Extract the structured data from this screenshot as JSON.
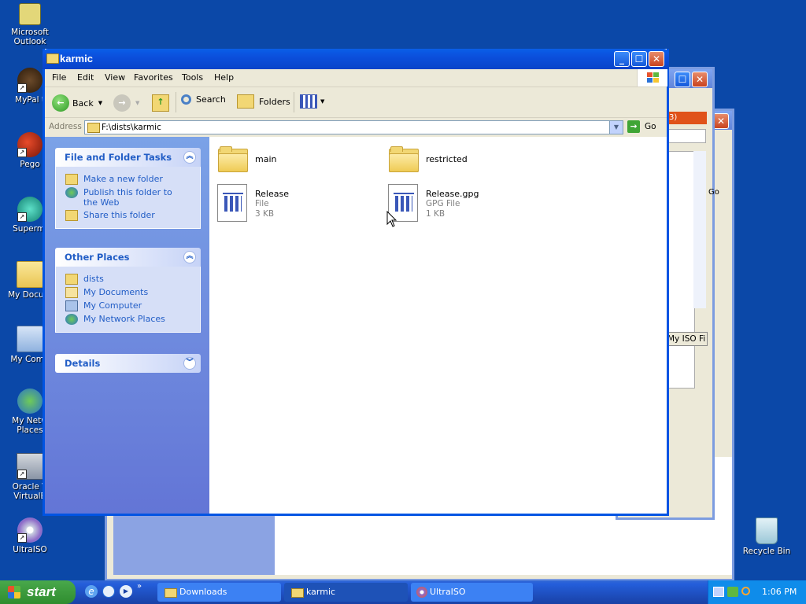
{
  "desktop": {
    "icons": [
      {
        "label": "Microsoft\nOutlook",
        "label1": "Microsoft",
        "label2": "Outlook"
      },
      {
        "label1": "MyPal t",
        "label2": ""
      },
      {
        "label1": "Pego",
        "label2": ""
      },
      {
        "label1": "Supermi",
        "label2": ""
      },
      {
        "label1": "My Docum",
        "label2": ""
      },
      {
        "label1": "My Comp",
        "label2": ""
      },
      {
        "label1": "My Netw",
        "label2": "Places"
      },
      {
        "label1": "Oracle V",
        "label2": "VirtualB"
      },
      {
        "label1": "UltraISO",
        "label2": ""
      }
    ],
    "recycle_bin": "Recycle Bin"
  },
  "background_window": {
    "fragments": [
      "My ISO Fi",
      "Go",
      "3)"
    ]
  },
  "window": {
    "title": "karmic",
    "menu": [
      "File",
      "Edit",
      "View",
      "Favorites",
      "Tools",
      "Help"
    ],
    "toolbar": {
      "back": "Back",
      "search": "Search",
      "folders": "Folders"
    },
    "address": {
      "label": "Address",
      "value": "F:\\dists\\karmic",
      "go": "Go"
    },
    "taskpane": {
      "file_tasks": {
        "title": "File and Folder Tasks",
        "items": [
          "Make a new folder",
          "Publish this folder to the Web",
          "Share this folder"
        ]
      },
      "other_places": {
        "title": "Other Places",
        "items": [
          "dists",
          "My Documents",
          "My Computer",
          "My Network Places"
        ]
      },
      "details": {
        "title": "Details"
      }
    },
    "files": [
      {
        "name": "main",
        "type": "",
        "size": "",
        "icon": "folder-icon"
      },
      {
        "name": "restricted",
        "type": "",
        "size": "",
        "icon": "folder-icon"
      },
      {
        "name": "Release",
        "type": "File",
        "size": "3 KB",
        "icon": "document-icon"
      },
      {
        "name": "Release.gpg",
        "type": "GPG File",
        "size": "1 KB",
        "icon": "document-icon"
      }
    ]
  },
  "taskbar": {
    "start": "start",
    "buttons": [
      "Downloads",
      "karmic",
      "UltraISO"
    ],
    "clock": "1:06 PM"
  }
}
